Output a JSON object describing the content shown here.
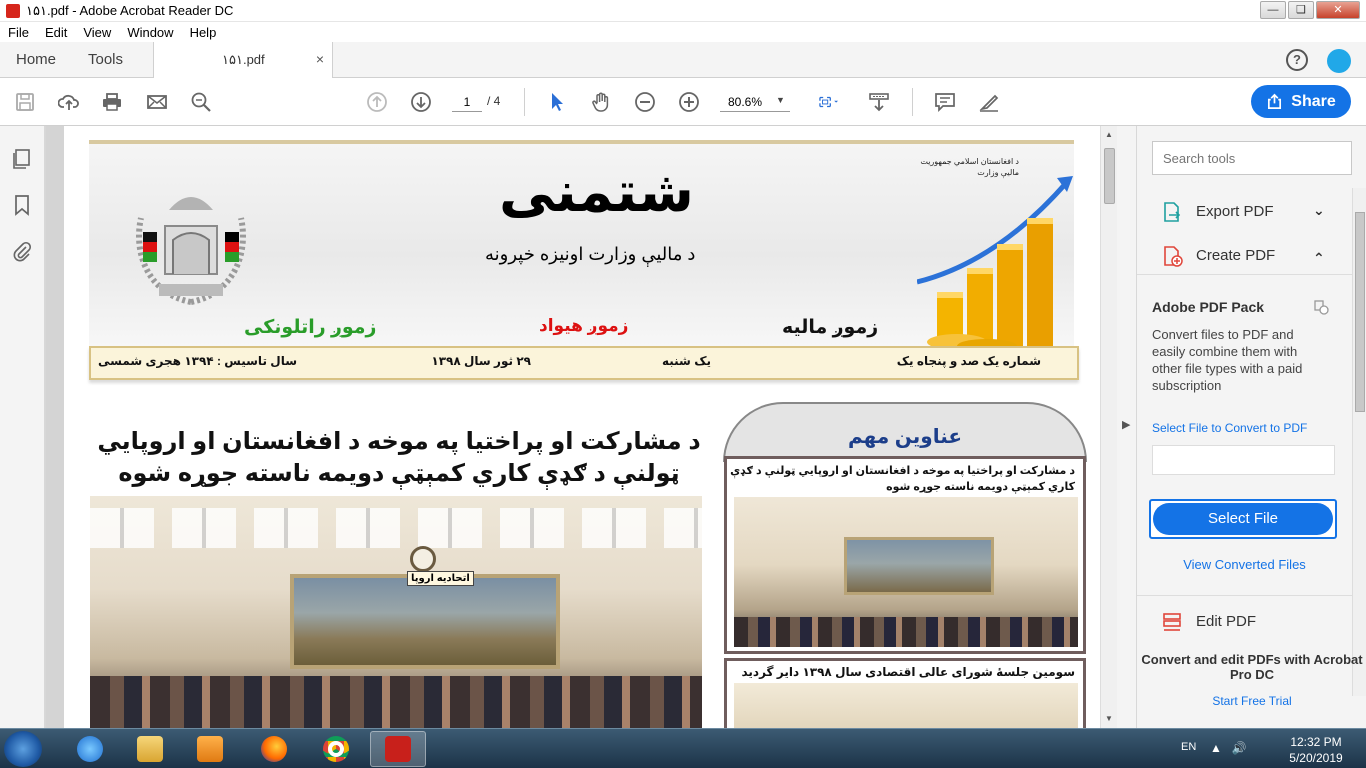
{
  "window": {
    "title": "١۵١.pdf - Adobe Acrobat Reader DC"
  },
  "menu": [
    "File",
    "Edit",
    "View",
    "Window",
    "Help"
  ],
  "tabs": {
    "home": "Home",
    "tools": "Tools",
    "document": "١۵١.pdf",
    "close": "×"
  },
  "toolbar": {
    "page_current": "1",
    "page_total": "/ 4",
    "zoom": "80.6%",
    "share_label": "Share"
  },
  "document": {
    "masthead": {
      "title": "شتمنی",
      "subtitle": "د مالیې وزارت اونیزه خپرونه",
      "ministry_line1": "د افغانستان اسلامي جمهوریت",
      "ministry_line2": "مالیې وزارت",
      "section_1": "زموږ مالیه",
      "section_2": "زموږ هیواد",
      "section_3": "زموږ راتلونکی"
    },
    "infobar": {
      "issue": "شماره یک صد و پنجاه  یک",
      "weekday": "یک شنبه",
      "date": "۲۹   ثور   سال ۱۳۹۸",
      "founded": "سال تاسیس : ۱۳۹۴ هجری شمسی"
    },
    "headline": "د مشارکت او پراختیا په موخه د افغانستان او اروپایي ټولنې د ګډې کاري کمېټې دویمه ناسته جوړه شوه",
    "photo_tag": "اتحادیه اروپا",
    "sidebar": {
      "title": "عناوین مهم",
      "item_1": "د مشارکت او پراختیا په موخه د افغانستان او اروپایي ټولنې د ګډې کاري کمېټې دویمه ناسته جوړه شوه",
      "item_2": "سومین جلسهٔ شورای عالی اقتصادی سال ۱۳۹۸ دایر گردید"
    }
  },
  "tools_panel": {
    "search_placeholder": "Search tools",
    "export_pdf": "Export PDF",
    "create_pdf": "Create PDF",
    "pack_title": "Adobe PDF Pack",
    "pack_desc": "Convert files to PDF and easily combine them with other file types with a paid subscription",
    "select_file_link": "Select File to Convert to PDF",
    "select_file_button": "Select File",
    "view_converted": "View Converted Files",
    "edit_pdf": "Edit PDF",
    "promo_text": "Convert and edit PDFs with Acrobat Pro DC",
    "promo_link": "Start Free Trial"
  },
  "taskbar": {
    "language": "EN",
    "time": "12:32 PM",
    "date": "5/20/2019",
    "apps": [
      "internet-explorer",
      "file-explorer",
      "media-player",
      "firefox",
      "chrome",
      "acrobat-reader"
    ]
  },
  "colors": {
    "accent": "#1473e6",
    "acrobat_red": "#d6261c"
  }
}
